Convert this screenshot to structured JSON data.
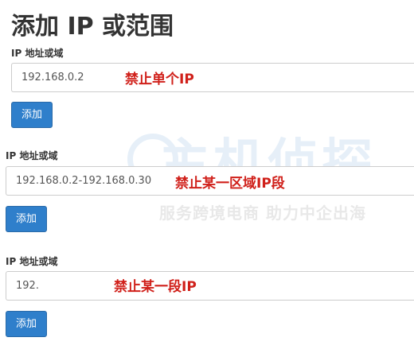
{
  "page_title": "添加 IP 或范围",
  "watermark": {
    "title": "主机侦探",
    "slogan": "服务跨境电商 助力中企出海"
  },
  "sections": [
    {
      "label": "IP 地址或域",
      "input_value": "192.168.0.2",
      "annotation": "禁止单个IP",
      "button_label": "添加"
    },
    {
      "label": "IP 地址或域",
      "input_value": "192.168.0.2-192.168.0.30",
      "annotation": "禁止某一区域IP段",
      "button_label": "添加"
    },
    {
      "label": "IP 地址或域",
      "input_value": "192.",
      "annotation": "禁止某一段IP",
      "button_label": "添加"
    }
  ],
  "colors": {
    "button_bg": "#2f7fcb",
    "annotation": "#d0201a",
    "watermark": "#4a8ed1"
  }
}
